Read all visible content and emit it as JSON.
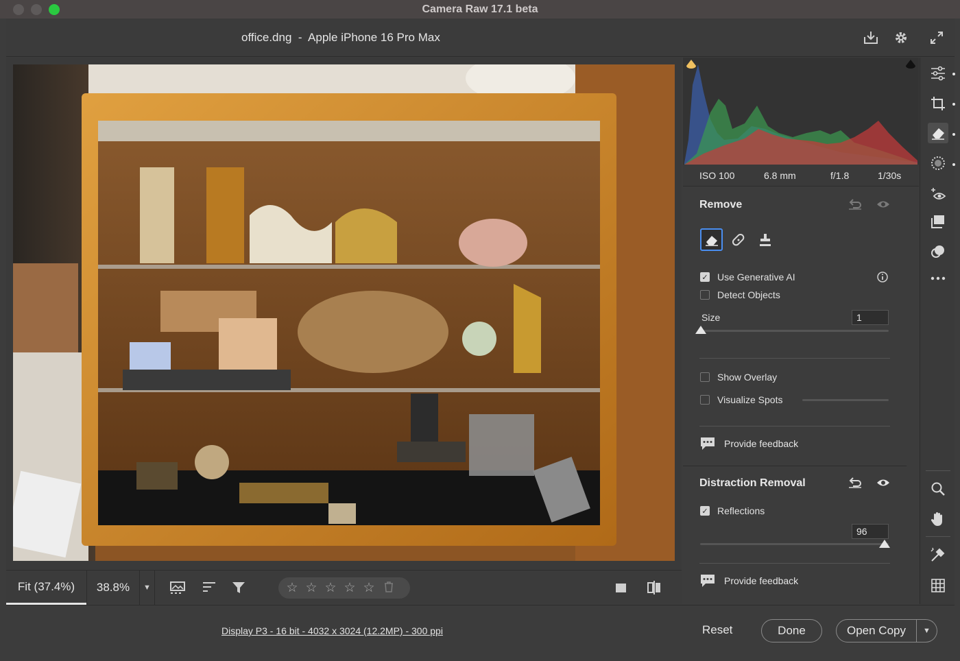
{
  "window": {
    "title": "Camera Raw 17.1 beta"
  },
  "header": {
    "filename": "office.dng  -  Apple iPhone 16 Pro Max"
  },
  "canvas_toolbar": {
    "zoom_fit": "Fit (37.4%)",
    "zoom_value": "38.8%",
    "rating_stars": 5
  },
  "exif": {
    "iso": "ISO 100",
    "focal": "6.8 mm",
    "aperture": "f/1.8",
    "shutter": "1/30s"
  },
  "remove": {
    "title": "Remove",
    "use_generative_ai": {
      "label": "Use Generative AI",
      "checked": true
    },
    "detect_objects": {
      "label": "Detect Objects",
      "checked": false
    },
    "size_label": "Size",
    "size_value": "1",
    "size_level": 0,
    "show_overlay": {
      "label": "Show Overlay",
      "checked": false
    },
    "visualize_spots": {
      "label": "Visualize Spots",
      "checked": false
    },
    "feedback": "Provide feedback"
  },
  "distraction": {
    "title": "Distraction Removal",
    "reflections": {
      "label": "Reflections",
      "checked": true
    },
    "value": "96",
    "level": 0.96,
    "feedback": "Provide feedback"
  },
  "bottom": {
    "info": "Display P3 - 16 bit - 4032 x 3024 (12.2MP) - 300 ppi",
    "reset": "Reset",
    "done": "Done",
    "open_copy": "Open Copy"
  },
  "colors": {
    "accent": "#4a8ef0",
    "traffic_green": "#2ac840"
  }
}
